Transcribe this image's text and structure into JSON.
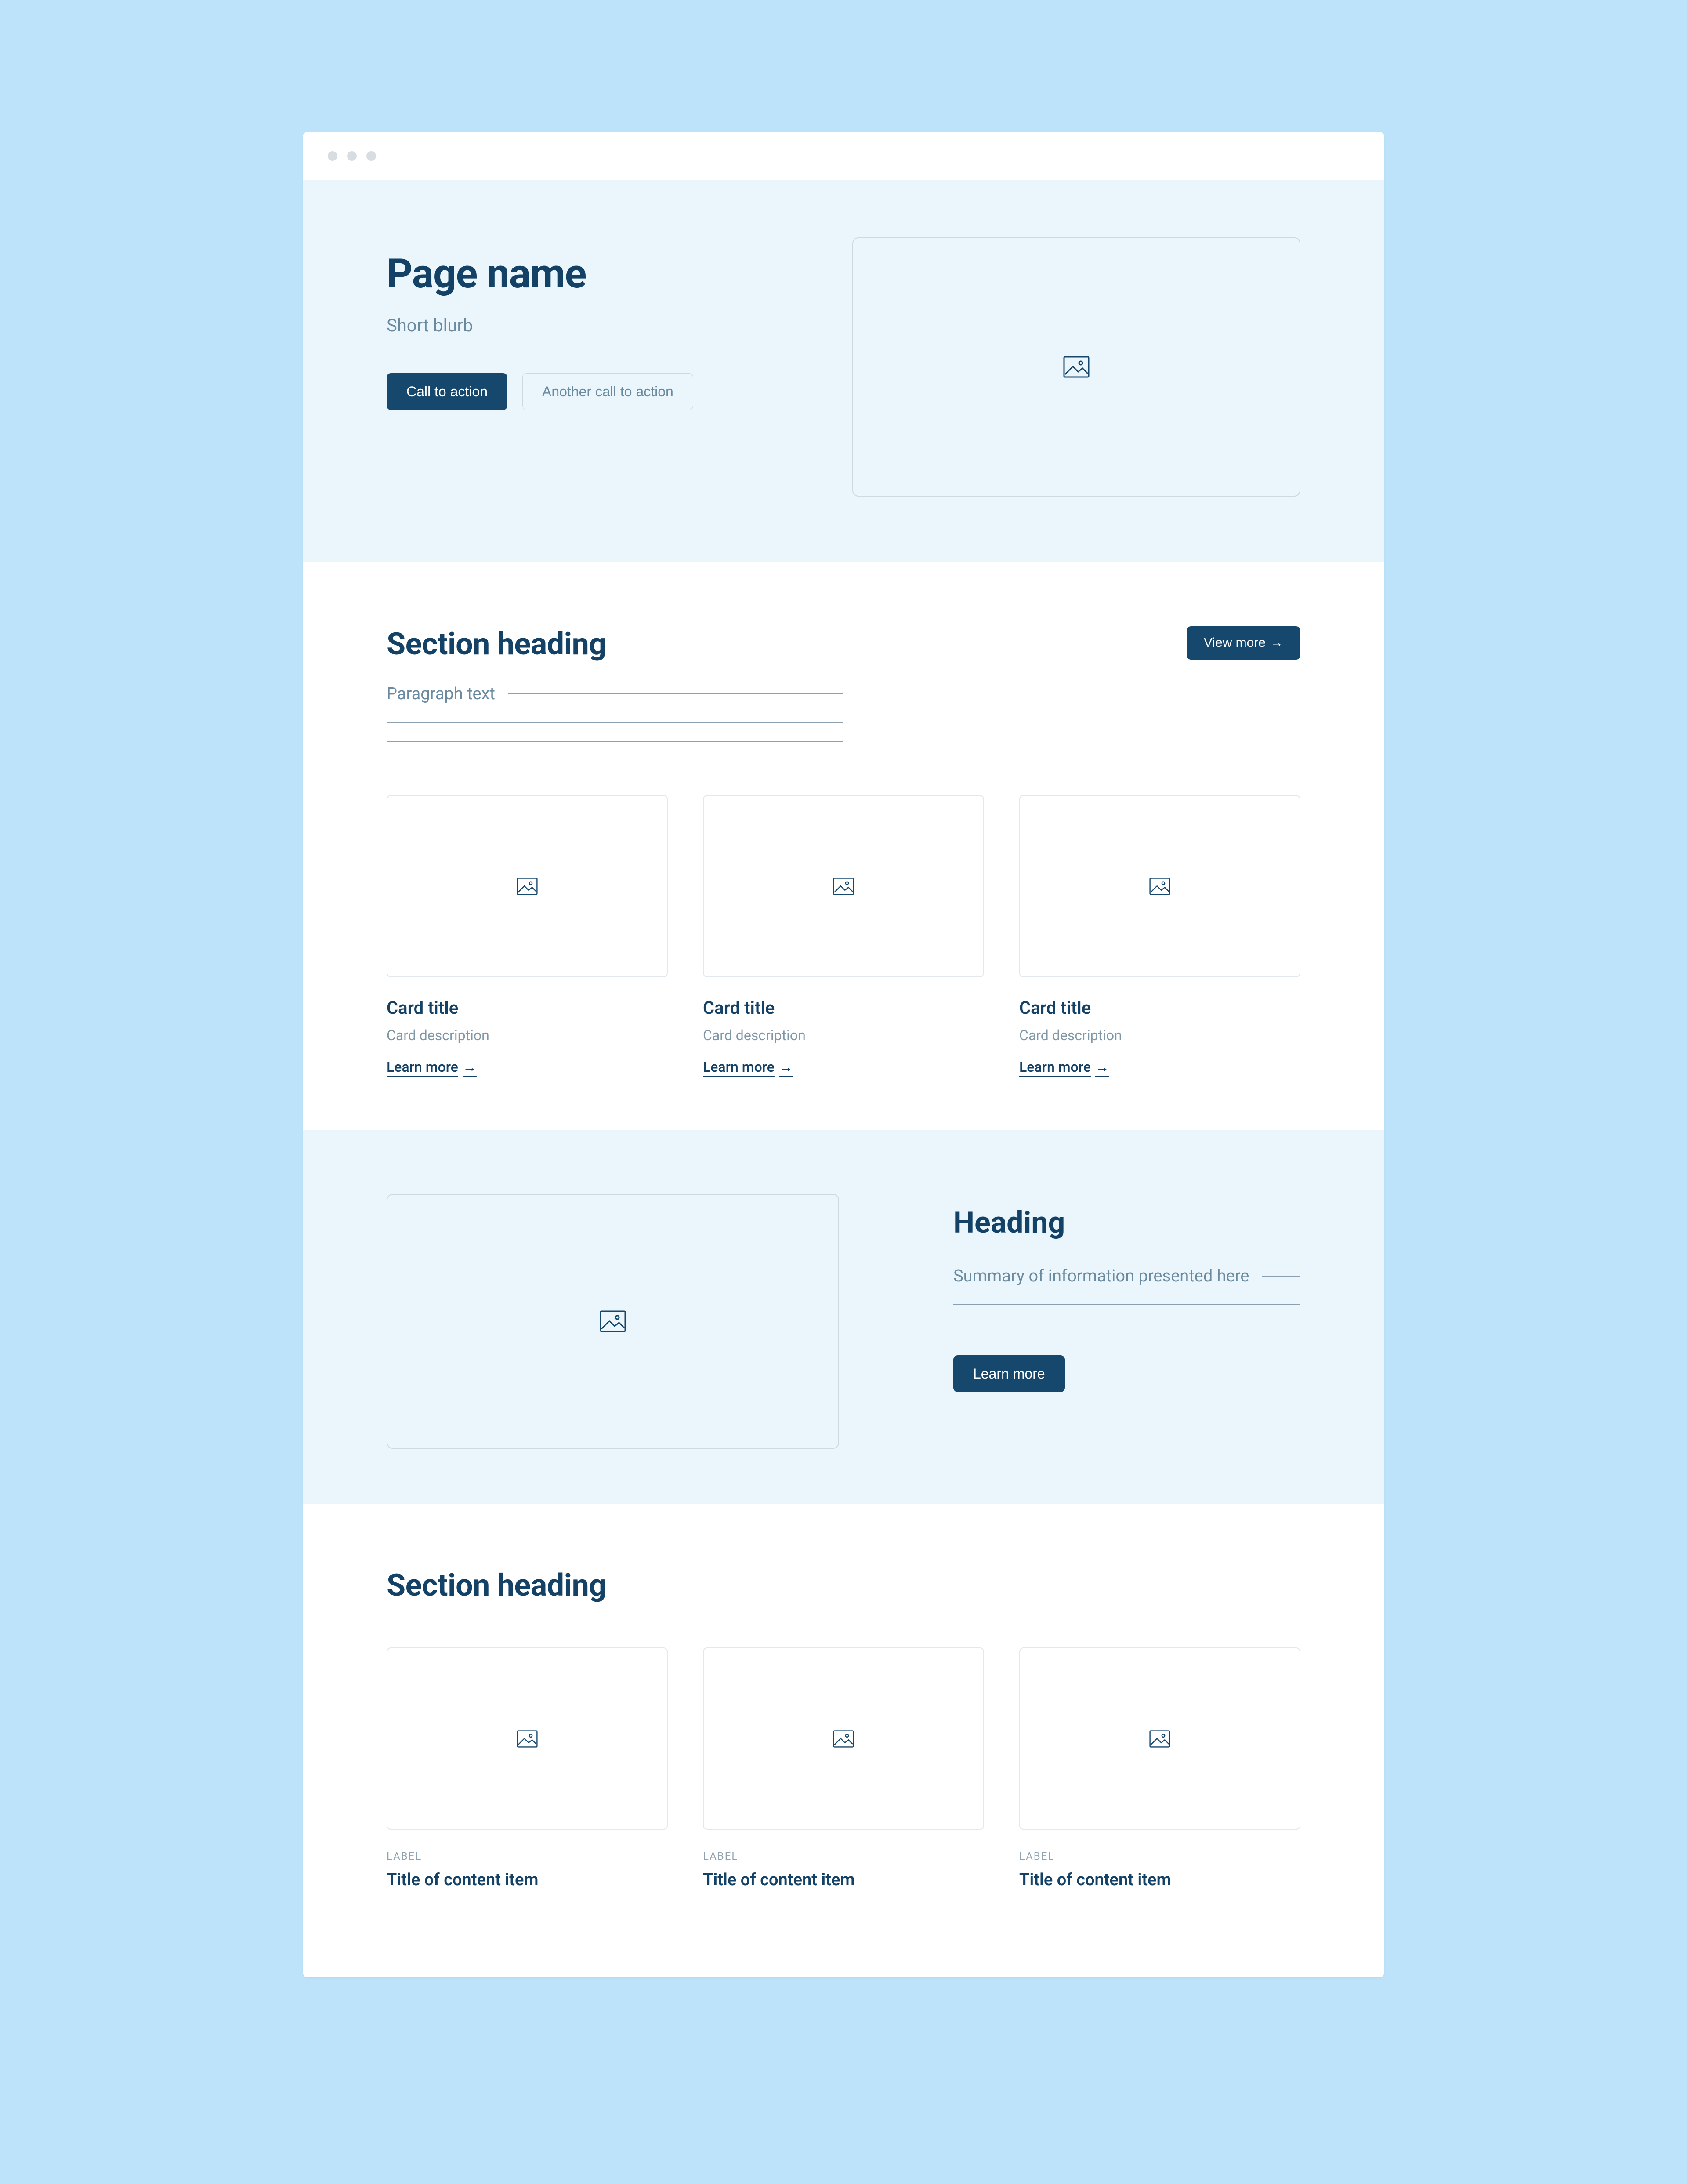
{
  "colors": {
    "page_bg": "#bce3f9",
    "hero_bg": "#eaf6fc",
    "ink": "#144166",
    "muted": "#6a8aa0",
    "button_primary": "#16486e"
  },
  "hero": {
    "page_title": "Page name",
    "blurb": "Short blurb",
    "cta_primary": "Call to action",
    "cta_secondary": "Another call to action"
  },
  "section_a": {
    "heading": "Section heading",
    "view_more_label": "View more",
    "view_more_arrow": "→",
    "paragraph_lead": "Paragraph text",
    "cards": [
      {
        "title": "Card title",
        "desc": "Card description",
        "link": "Learn more",
        "arrow": "→"
      },
      {
        "title": "Card title",
        "desc": "Card description",
        "link": "Learn more",
        "arrow": "→"
      },
      {
        "title": "Card title",
        "desc": "Card description",
        "link": "Learn more",
        "arrow": "→"
      }
    ]
  },
  "highlight": {
    "heading": "Heading",
    "summary_lead": "Summary of information presented here",
    "learn_more": "Learn more"
  },
  "section_b": {
    "heading": "Section heading",
    "items": [
      {
        "label": "LABEL",
        "title": "Title of content item"
      },
      {
        "label": "LABEL",
        "title": "Title of content item"
      },
      {
        "label": "LABEL",
        "title": "Title of content item"
      }
    ]
  }
}
